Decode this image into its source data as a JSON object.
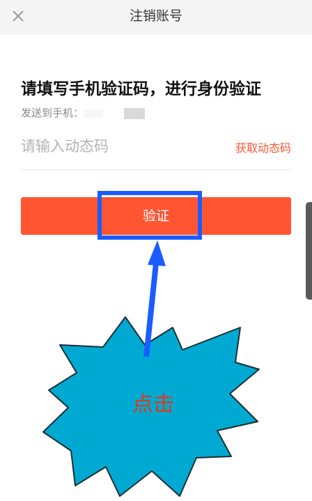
{
  "header": {
    "title": "注销账号",
    "close_icon": "close-icon"
  },
  "verification": {
    "heading": "请填写手机验证码，进行身份验证",
    "sent_to_label": "发送到手机：",
    "code_placeholder": "请输入动态码",
    "code_value": "",
    "get_code_label": "获取动态码",
    "verify_label": "验证"
  },
  "annotation": {
    "callout_text": "点击",
    "highlight_color": "#1a5cff",
    "arrow_color": "#1a5cff",
    "burst_color": "#00a9d1",
    "text_color": "#e03a1e"
  },
  "colors": {
    "accent": "#ff5533",
    "topbar_bg": "#f4f4f4"
  }
}
